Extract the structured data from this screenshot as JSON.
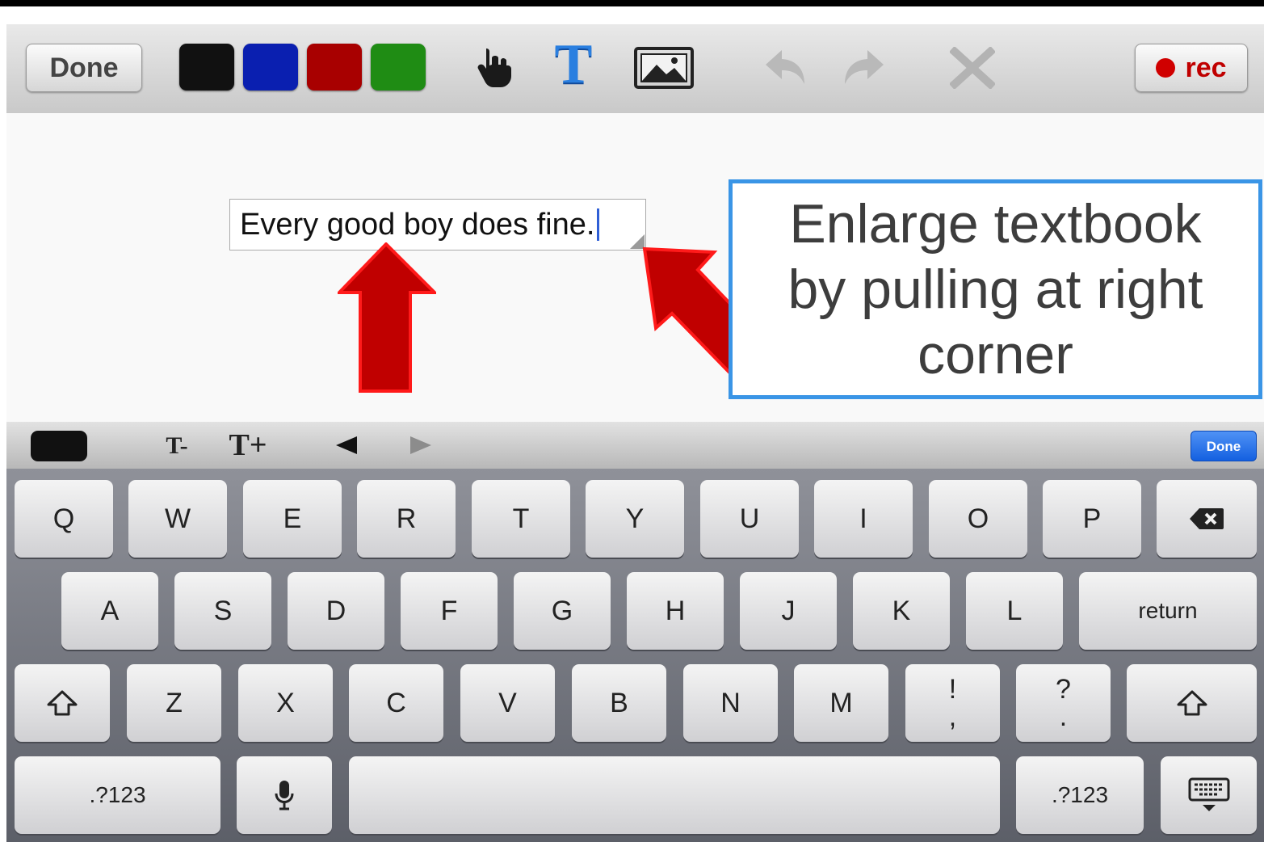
{
  "toolbar": {
    "done_label": "Done",
    "rec_label": "rec",
    "colors": [
      "#111111",
      "#0a1fb0",
      "#a80000",
      "#1f8c14"
    ],
    "text_tool_glyph": "T"
  },
  "canvas": {
    "textbox_text": "Every good boy does fine.",
    "callout_text": "Enlarge textbook by pulling at right corner"
  },
  "keyboard_bar": {
    "font_smaller": "T-",
    "font_larger": "T+",
    "done_label": "Done"
  },
  "keyboard": {
    "row1": [
      "Q",
      "W",
      "E",
      "R",
      "T",
      "Y",
      "U",
      "I",
      "O",
      "P"
    ],
    "row2": [
      "A",
      "S",
      "D",
      "F",
      "G",
      "H",
      "J",
      "K",
      "L"
    ],
    "return_label": "return",
    "row3": [
      "Z",
      "X",
      "C",
      "V",
      "B",
      "N",
      "M"
    ],
    "punct1": {
      "top": "!",
      "bottom": ","
    },
    "punct2": {
      "top": "?",
      "bottom": "."
    },
    "numbers_label": ".?123"
  }
}
